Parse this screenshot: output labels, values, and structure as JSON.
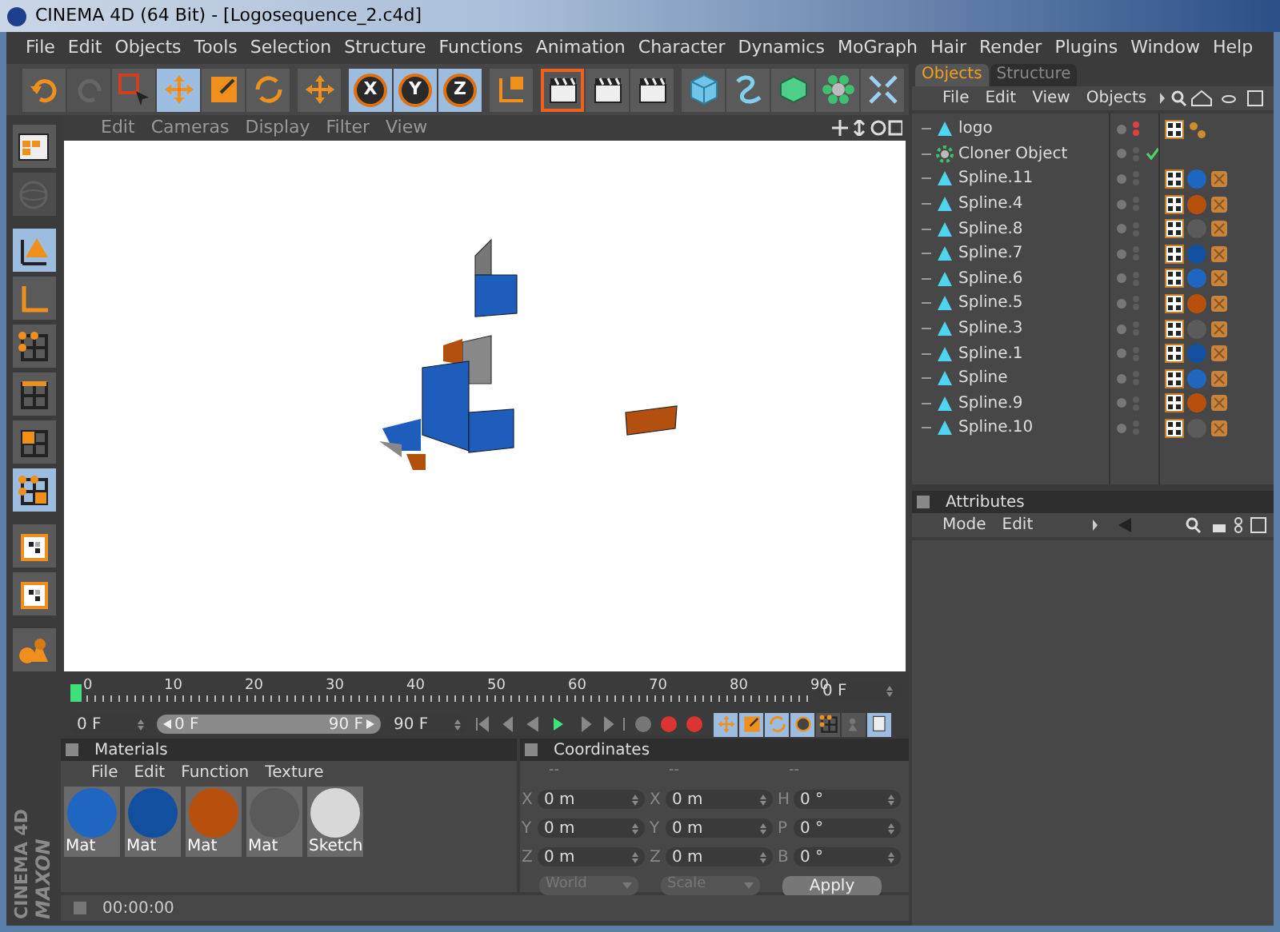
{
  "window": {
    "title": "CINEMA 4D (64 Bit) - [Logosequence_2.c4d]"
  },
  "menu": [
    "File",
    "Edit",
    "Objects",
    "Tools",
    "Selection",
    "Structure",
    "Functions",
    "Animation",
    "Character",
    "Dynamics",
    "MoGraph",
    "Hair",
    "Render",
    "Plugins",
    "Window",
    "Help"
  ],
  "toolbar": {
    "groups": [
      [
        {
          "kind": "undo",
          "selected": false,
          "disabled": false
        },
        {
          "kind": "redo",
          "selected": false,
          "disabled": true
        },
        {
          "kind": "select",
          "selected": false,
          "disabled": false
        },
        {
          "kind": "move",
          "selected": true,
          "disabled": false
        },
        {
          "kind": "scale",
          "selected": false,
          "disabled": false
        },
        {
          "kind": "rotate",
          "selected": false,
          "disabled": false
        }
      ],
      [
        {
          "kind": "move",
          "selected": false,
          "disabled": false
        }
      ],
      [
        {
          "kind": "coords",
          "selected": false,
          "disabled": false
        }
      ],
      [
        {
          "kind": "render-view",
          "selected": true,
          "disabled": false
        },
        {
          "kind": "render",
          "selected": false,
          "disabled": false
        },
        {
          "kind": "render-settings",
          "selected": false,
          "disabled": false
        }
      ],
      [
        {
          "kind": "cube",
          "selected": false,
          "disabled": false
        },
        {
          "kind": "spline",
          "selected": false,
          "disabled": false
        },
        {
          "kind": "nurbs",
          "selected": false,
          "disabled": false
        },
        {
          "kind": "cloner",
          "selected": false,
          "disabled": false
        },
        {
          "kind": "deformer",
          "selected": false,
          "disabled": false
        }
      ]
    ],
    "axes": [
      {
        "label": "X",
        "selected": true
      },
      {
        "label": "Y",
        "selected": true
      },
      {
        "label": "Z",
        "selected": true
      }
    ]
  },
  "left_toolbar": [
    {
      "kind": "layout",
      "selected": false,
      "disabled": false
    },
    {
      "kind": "sphere",
      "selected": false,
      "disabled": true
    },
    {
      "kind": "object",
      "selected": true,
      "disabled": false
    },
    {
      "kind": "axis",
      "selected": false,
      "disabled": false
    },
    {
      "kind": "points",
      "selected": false,
      "disabled": false
    },
    {
      "kind": "edges",
      "selected": false,
      "disabled": false
    },
    {
      "kind": "polygons",
      "selected": false,
      "disabled": false
    },
    {
      "kind": "uvw",
      "selected": true,
      "disabled": false
    },
    {
      "kind": "texture",
      "selected": false,
      "disabled": false
    },
    {
      "kind": "texture-axis",
      "selected": false,
      "disabled": false
    },
    {
      "kind": "primitives",
      "selected": false,
      "disabled": false
    }
  ],
  "viewport": {
    "menu": [
      "Edit",
      "Cameras",
      "Display",
      "Filter",
      "View"
    ]
  },
  "timeline": {
    "ticks": [
      "0",
      "10",
      "20",
      "30",
      "40",
      "50",
      "60",
      "70",
      "80",
      "90"
    ],
    "current_frame": "0 F",
    "start": "0 F",
    "range": {
      "start": "0 F",
      "end": "90 F",
      "level": 1
    },
    "end": "90 F"
  },
  "key_filters": [
    {
      "kind": "move",
      "selected": true
    },
    {
      "kind": "scale",
      "selected": true
    },
    {
      "kind": "rotate",
      "selected": true
    },
    {
      "kind": "param",
      "selected": true
    },
    {
      "kind": "points",
      "selected": false
    },
    {
      "kind": "figure",
      "selected": false
    },
    {
      "kind": "sheet",
      "selected": true
    }
  ],
  "materials": {
    "title": "Materials",
    "menu": [
      "File",
      "Edit",
      "Function",
      "Texture"
    ],
    "items": [
      {
        "name": "Mat",
        "color": "#1f66c0"
      },
      {
        "name": "Mat",
        "color": "#124f9e"
      },
      {
        "name": "Mat",
        "color": "#b8500d"
      },
      {
        "name": "Mat",
        "color": "#5a5a5a"
      },
      {
        "name": "Sketch",
        "color": "#d8d8d8"
      }
    ]
  },
  "coordinates": {
    "title": "Coordinates",
    "headers": [
      "--",
      "--",
      "--"
    ],
    "columns": [
      [
        {
          "axis": "X",
          "value": "0 m"
        },
        {
          "axis": "Y",
          "value": "0 m"
        },
        {
          "axis": "Z",
          "value": "0 m"
        }
      ],
      [
        {
          "axis": "X",
          "value": "0 m"
        },
        {
          "axis": "Y",
          "value": "0 m"
        },
        {
          "axis": "Z",
          "value": "0 m"
        }
      ],
      [
        {
          "axis": "H",
          "value": "0 °"
        },
        {
          "axis": "P",
          "value": "0 °"
        },
        {
          "axis": "B",
          "value": "0 °"
        }
      ]
    ],
    "modes": [
      {
        "label": "World",
        "disabled": true
      },
      {
        "label": "Scale",
        "disabled": true
      }
    ],
    "apply": "Apply"
  },
  "status": {
    "time": "00:00:00"
  },
  "brand": {
    "company": "MAXON",
    "product": "CINEMA 4D"
  },
  "objects": {
    "tabs": [
      {
        "label": "Objects",
        "selected": true
      },
      {
        "label": "Structure",
        "selected": false
      }
    ],
    "menu": [
      "File",
      "Edit",
      "View",
      "Objects"
    ],
    "items": [
      {
        "name": "logo",
        "kind": "spline",
        "hidden": true,
        "checked": false
      },
      {
        "name": "Cloner Object",
        "kind": "cloner",
        "hidden": false,
        "checked": true
      },
      {
        "name": "Spline.11",
        "kind": "spline",
        "hidden": false,
        "checked": false,
        "color": "#1f66c0"
      },
      {
        "name": "Spline.4",
        "kind": "spline",
        "hidden": false,
        "checked": false,
        "color": "#b8500d"
      },
      {
        "name": "Spline.8",
        "kind": "spline",
        "hidden": false,
        "checked": false,
        "color": "#5a5a5a"
      },
      {
        "name": "Spline.7",
        "kind": "spline",
        "hidden": false,
        "checked": false,
        "color": "#124f9e"
      },
      {
        "name": "Spline.6",
        "kind": "spline",
        "hidden": false,
        "checked": false,
        "color": "#1f66c0"
      },
      {
        "name": "Spline.5",
        "kind": "spline",
        "hidden": false,
        "checked": false,
        "color": "#b8500d"
      },
      {
        "name": "Spline.3",
        "kind": "spline",
        "hidden": false,
        "checked": false,
        "color": "#5a5a5a"
      },
      {
        "name": "Spline.1",
        "kind": "spline",
        "hidden": false,
        "checked": false,
        "color": "#124f9e"
      },
      {
        "name": "Spline",
        "kind": "spline",
        "hidden": false,
        "checked": false,
        "color": "#1f66c0"
      },
      {
        "name": "Spline.9",
        "kind": "spline",
        "hidden": false,
        "checked": false,
        "color": "#b8500d"
      },
      {
        "name": "Spline.10",
        "kind": "spline",
        "hidden": false,
        "checked": false,
        "color": "#5a5a5a"
      }
    ]
  },
  "attributes": {
    "title": "Attributes",
    "menu": [
      "Mode",
      "Edit"
    ]
  }
}
